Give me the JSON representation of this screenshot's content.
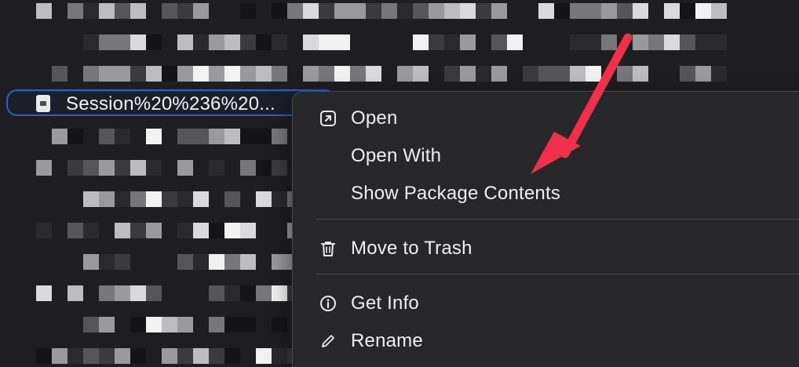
{
  "selected_file": {
    "name": "Session%20%236%20..."
  },
  "context_menu": {
    "items": [
      {
        "label": "Open",
        "icon": "open-arrow-icon"
      },
      {
        "label": "Open With",
        "icon": ""
      },
      {
        "label": "Show Package Contents",
        "icon": ""
      },
      {
        "label": "Move to Trash",
        "icon": "trash-icon"
      },
      {
        "label": "Get Info",
        "icon": "info-icon"
      },
      {
        "label": "Rename",
        "icon": "pencil-icon"
      }
    ]
  },
  "annotation": {
    "arrow_color": "#f0304a"
  },
  "colors": {
    "selection_border": "#1f64d8",
    "menu_background": "#27272a",
    "window_background": "#1e1e20"
  }
}
